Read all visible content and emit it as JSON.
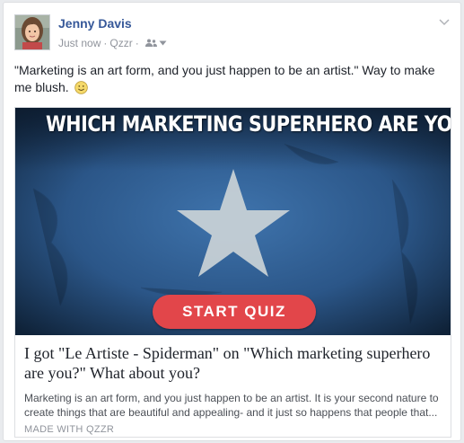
{
  "post": {
    "author": "Jenny Davis",
    "timestamp": "Just now",
    "separator": "·",
    "app": "Qzzr",
    "privacy_icon": "friends-icon",
    "menu_icon": "chevron-down-icon",
    "message_text": "\"Marketing is an art form, and you just happen to be an artist.\" Way to make me blush.",
    "emoji": "smile-emoji"
  },
  "attachment": {
    "image_title": "WHICH MARKETING SUPERHERO ARE YOU?",
    "button_label": "START QUIZ",
    "title": "I got \"Le Artiste - Spiderman\" on \"Which marketing superhero are you?\" What about you?",
    "description": "Marketing is an art form, and you just happen to be an artist. It is your second nature to create things that are beautiful and appealing- and it just so happens that people that...",
    "source": "MADE WITH QZZR"
  },
  "colors": {
    "author_link": "#365899",
    "meta_gray": "#90949c",
    "button_red": "#e2464a",
    "hero_blue": "#2f5c94",
    "star": "#c9d2d6"
  }
}
